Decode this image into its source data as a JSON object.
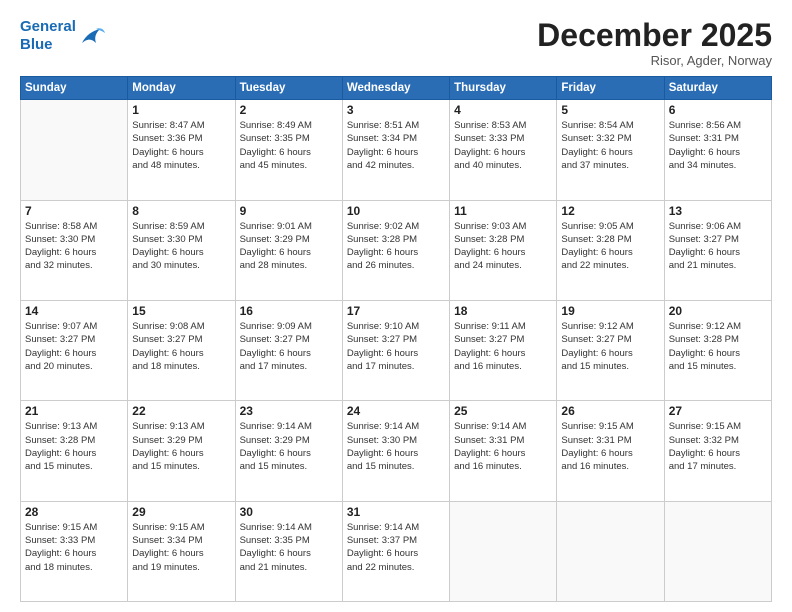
{
  "logo": {
    "line1": "General",
    "line2": "Blue"
  },
  "title": "December 2025",
  "subtitle": "Risor, Agder, Norway",
  "days": [
    "Sunday",
    "Monday",
    "Tuesday",
    "Wednesday",
    "Thursday",
    "Friday",
    "Saturday"
  ],
  "weeks": [
    [
      {
        "date": "",
        "info": ""
      },
      {
        "date": "1",
        "info": "Sunrise: 8:47 AM\nSunset: 3:36 PM\nDaylight: 6 hours\nand 48 minutes."
      },
      {
        "date": "2",
        "info": "Sunrise: 8:49 AM\nSunset: 3:35 PM\nDaylight: 6 hours\nand 45 minutes."
      },
      {
        "date": "3",
        "info": "Sunrise: 8:51 AM\nSunset: 3:34 PM\nDaylight: 6 hours\nand 42 minutes."
      },
      {
        "date": "4",
        "info": "Sunrise: 8:53 AM\nSunset: 3:33 PM\nDaylight: 6 hours\nand 40 minutes."
      },
      {
        "date": "5",
        "info": "Sunrise: 8:54 AM\nSunset: 3:32 PM\nDaylight: 6 hours\nand 37 minutes."
      },
      {
        "date": "6",
        "info": "Sunrise: 8:56 AM\nSunset: 3:31 PM\nDaylight: 6 hours\nand 34 minutes."
      }
    ],
    [
      {
        "date": "7",
        "info": "Sunrise: 8:58 AM\nSunset: 3:30 PM\nDaylight: 6 hours\nand 32 minutes."
      },
      {
        "date": "8",
        "info": "Sunrise: 8:59 AM\nSunset: 3:30 PM\nDaylight: 6 hours\nand 30 minutes."
      },
      {
        "date": "9",
        "info": "Sunrise: 9:01 AM\nSunset: 3:29 PM\nDaylight: 6 hours\nand 28 minutes."
      },
      {
        "date": "10",
        "info": "Sunrise: 9:02 AM\nSunset: 3:28 PM\nDaylight: 6 hours\nand 26 minutes."
      },
      {
        "date": "11",
        "info": "Sunrise: 9:03 AM\nSunset: 3:28 PM\nDaylight: 6 hours\nand 24 minutes."
      },
      {
        "date": "12",
        "info": "Sunrise: 9:05 AM\nSunset: 3:28 PM\nDaylight: 6 hours\nand 22 minutes."
      },
      {
        "date": "13",
        "info": "Sunrise: 9:06 AM\nSunset: 3:27 PM\nDaylight: 6 hours\nand 21 minutes."
      }
    ],
    [
      {
        "date": "14",
        "info": "Sunrise: 9:07 AM\nSunset: 3:27 PM\nDaylight: 6 hours\nand 20 minutes."
      },
      {
        "date": "15",
        "info": "Sunrise: 9:08 AM\nSunset: 3:27 PM\nDaylight: 6 hours\nand 18 minutes."
      },
      {
        "date": "16",
        "info": "Sunrise: 9:09 AM\nSunset: 3:27 PM\nDaylight: 6 hours\nand 17 minutes."
      },
      {
        "date": "17",
        "info": "Sunrise: 9:10 AM\nSunset: 3:27 PM\nDaylight: 6 hours\nand 17 minutes."
      },
      {
        "date": "18",
        "info": "Sunrise: 9:11 AM\nSunset: 3:27 PM\nDaylight: 6 hours\nand 16 minutes."
      },
      {
        "date": "19",
        "info": "Sunrise: 9:12 AM\nSunset: 3:27 PM\nDaylight: 6 hours\nand 15 minutes."
      },
      {
        "date": "20",
        "info": "Sunrise: 9:12 AM\nSunset: 3:28 PM\nDaylight: 6 hours\nand 15 minutes."
      }
    ],
    [
      {
        "date": "21",
        "info": "Sunrise: 9:13 AM\nSunset: 3:28 PM\nDaylight: 6 hours\nand 15 minutes."
      },
      {
        "date": "22",
        "info": "Sunrise: 9:13 AM\nSunset: 3:29 PM\nDaylight: 6 hours\nand 15 minutes."
      },
      {
        "date": "23",
        "info": "Sunrise: 9:14 AM\nSunset: 3:29 PM\nDaylight: 6 hours\nand 15 minutes."
      },
      {
        "date": "24",
        "info": "Sunrise: 9:14 AM\nSunset: 3:30 PM\nDaylight: 6 hours\nand 15 minutes."
      },
      {
        "date": "25",
        "info": "Sunrise: 9:14 AM\nSunset: 3:31 PM\nDaylight: 6 hours\nand 16 minutes."
      },
      {
        "date": "26",
        "info": "Sunrise: 9:15 AM\nSunset: 3:31 PM\nDaylight: 6 hours\nand 16 minutes."
      },
      {
        "date": "27",
        "info": "Sunrise: 9:15 AM\nSunset: 3:32 PM\nDaylight: 6 hours\nand 17 minutes."
      }
    ],
    [
      {
        "date": "28",
        "info": "Sunrise: 9:15 AM\nSunset: 3:33 PM\nDaylight: 6 hours\nand 18 minutes."
      },
      {
        "date": "29",
        "info": "Sunrise: 9:15 AM\nSunset: 3:34 PM\nDaylight: 6 hours\nand 19 minutes."
      },
      {
        "date": "30",
        "info": "Sunrise: 9:14 AM\nSunset: 3:35 PM\nDaylight: 6 hours\nand 21 minutes."
      },
      {
        "date": "31",
        "info": "Sunrise: 9:14 AM\nSunset: 3:37 PM\nDaylight: 6 hours\nand 22 minutes."
      },
      {
        "date": "",
        "info": ""
      },
      {
        "date": "",
        "info": ""
      },
      {
        "date": "",
        "info": ""
      }
    ]
  ]
}
